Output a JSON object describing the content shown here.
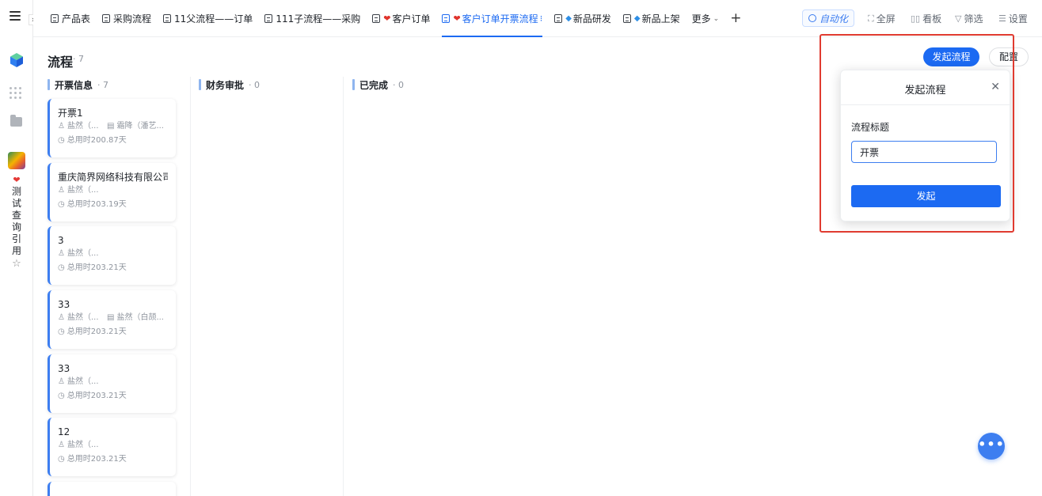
{
  "nav": {
    "vertical_app_name": [
      "测",
      "试",
      "查",
      "询",
      "引",
      "用"
    ],
    "heart": "❤"
  },
  "tabs": [
    {
      "label": "产品表",
      "icon": "table-icon",
      "prefix": "",
      "active": false
    },
    {
      "label": "采购流程",
      "icon": "flow-icon",
      "prefix": "",
      "active": false
    },
    {
      "label": "11父流程——订单",
      "icon": "flow-icon",
      "prefix": "",
      "active": false
    },
    {
      "label": "111子流程——采购",
      "icon": "flow-icon",
      "prefix": "",
      "active": false
    },
    {
      "label": "客户订单",
      "icon": "form-icon",
      "prefix": "heart",
      "active": false
    },
    {
      "label": "客户订单开票流程",
      "icon": "flow-icon",
      "prefix": "heart",
      "active": true
    },
    {
      "label": "新品研发",
      "icon": "flow-icon",
      "prefix": "gem",
      "active": false
    },
    {
      "label": "新品上架",
      "icon": "flow-icon",
      "prefix": "gem",
      "active": false
    }
  ],
  "more_label": "更多",
  "toolbar": {
    "automation": "自动化",
    "fullscreen": "全屏",
    "board": "看板",
    "filter": "筛选",
    "settings": "设置"
  },
  "page": {
    "title": "流程",
    "count": "· 7",
    "start_button": "发起流程",
    "config_button": "配置"
  },
  "columns": [
    {
      "name": "开票信息",
      "count": "· 7"
    },
    {
      "name": "财务审批",
      "count": "· 0"
    },
    {
      "name": "已完成",
      "count": "· 0"
    }
  ],
  "cards": [
    {
      "title": "开票1",
      "meta1": "盐然（...",
      "meta2": "霜降（潘艺...",
      "time": "总用时200.87天"
    },
    {
      "title": "重庆简界网络科技有限公司",
      "meta1": "盐然（...",
      "meta2": "",
      "time": "总用时203.19天"
    },
    {
      "title": "3",
      "meta1": "盐然（...",
      "meta2": "",
      "time": "总用时203.21天"
    },
    {
      "title": "33",
      "meta1": "盐然（...",
      "meta2": "盐然（白颉...",
      "time": "总用时203.21天"
    },
    {
      "title": "33",
      "meta1": "盐然（...",
      "meta2": "",
      "time": "总用时203.21天"
    },
    {
      "title": "12",
      "meta1": "盐然（...",
      "meta2": "",
      "time": "总用时203.21天"
    }
  ],
  "popover": {
    "title": "发起流程",
    "field_label": "流程标题",
    "field_value": "开票",
    "submit": "发起"
  },
  "colors": {
    "accent": "#1c6af2",
    "highlight": "#e03b30",
    "heart": "#e0342c"
  }
}
